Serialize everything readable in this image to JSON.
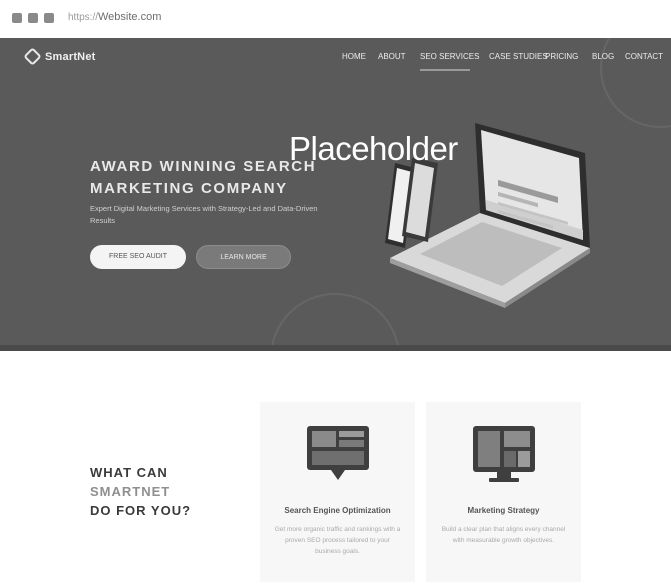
{
  "browser": {
    "url_prefix": "https://",
    "url": "Website.com"
  },
  "header": {
    "logo": "SmartNet",
    "nav": [
      "HOME",
      "ABOUT",
      "SEO SERVICES",
      "CASE STUDIES",
      "PRICING",
      "BLOG",
      "CONTACT"
    ],
    "active_nav": "SEO SERVICES"
  },
  "hero": {
    "headline_line1": "AWARD WINNING SEARCH",
    "headline_line2": "MARKETING COMPANY",
    "subtext": "Expert Digital Marketing Services with Strategy-Led and Data-Driven Results",
    "primary_button": "FREE SEO AUDIT",
    "secondary_button": "LEARN MORE",
    "overlay_text": "Placeholder"
  },
  "services": {
    "title_line1": "WHAT CAN",
    "title_line2": "SMARTNET",
    "title_line3": "DO FOR YOU?",
    "cards": [
      {
        "icon": "seo-chart-icon",
        "title": "Search Engine Optimization",
        "desc": "Get more organic traffic and rankings with a proven SEO process tailored to your business goals."
      },
      {
        "icon": "marketing-dashboard-icon",
        "title": "Marketing Strategy",
        "desc": "Build a clear plan that aligns every channel with measurable growth objectives."
      }
    ]
  },
  "colors": {
    "hero_bg": "#5a5a5a",
    "accent": "#ffffff"
  }
}
